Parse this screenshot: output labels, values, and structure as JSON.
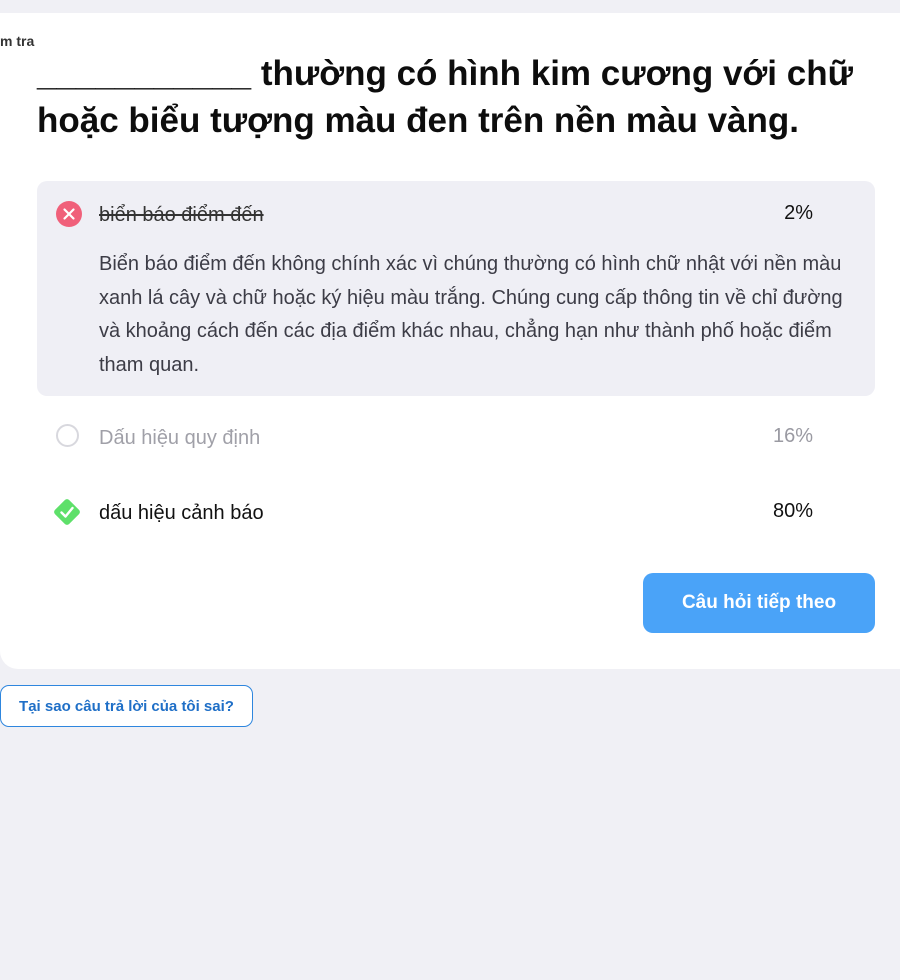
{
  "breadcrumb": "m tra",
  "question": "___________ thường có hình kim cương với chữ hoặc biểu tượng màu đen trên nền màu vàng.",
  "options": [
    {
      "label": "biển báo điểm đến",
      "percent": "2%",
      "state": "wrong-selected",
      "explanation": "Biển báo điểm đến không chính xác vì chúng thường có hình chữ nhật với nền màu xanh lá cây và chữ hoặc ký hiệu màu trắng. Chúng cung cấp thông tin về chỉ đường và khoảng cách đến các địa điểm khác nhau, chẳng hạn như thành phố hoặc điểm tham quan."
    },
    {
      "label": "Dấu hiệu quy định",
      "percent": "16%",
      "state": "unselected"
    },
    {
      "label": "dấu hiệu cảnh báo",
      "percent": "80%",
      "state": "correct"
    }
  ],
  "buttons": {
    "next": "Câu hỏi tiếp theo",
    "why_wrong": "Tại sao câu trả lời của tôi sai?"
  },
  "colors": {
    "wrong": "#f0607a",
    "correct": "#5ee06a",
    "primary": "#4aa3f8",
    "link": "#1f6fc7"
  },
  "icons": {
    "wrong": "x-circle-icon",
    "unselected": "radio-empty-icon",
    "correct": "check-diamond-icon"
  }
}
